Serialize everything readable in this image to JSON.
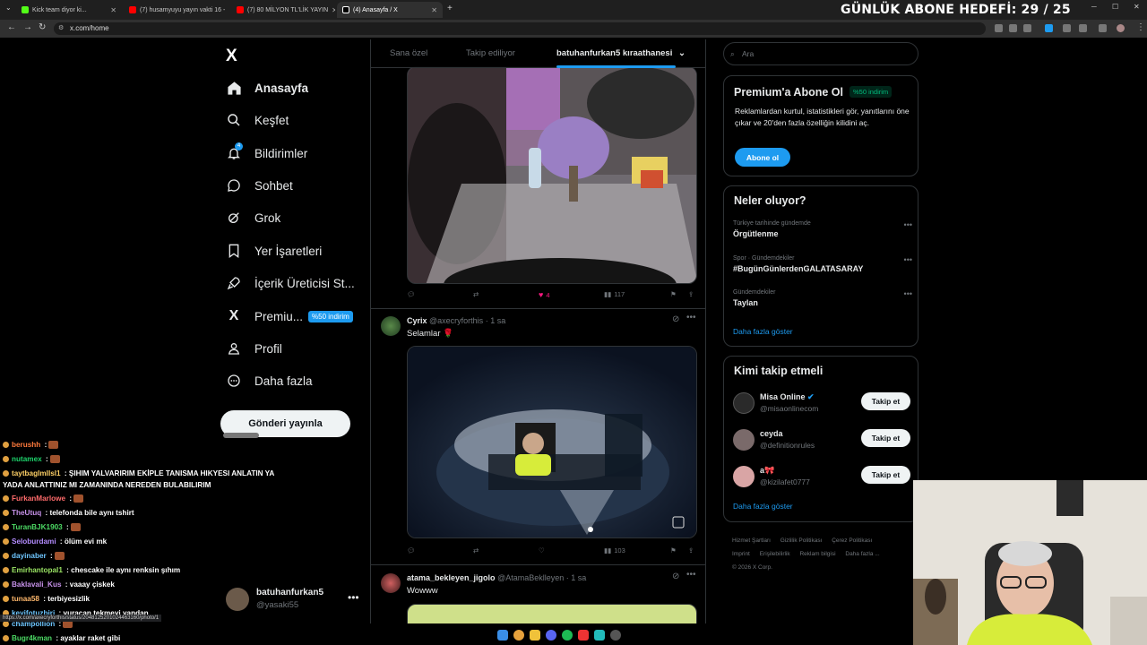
{
  "browser": {
    "tabs": [
      {
        "title": "Kick team diyor ki...",
        "color": "#53fc18"
      },
      {
        "title": "(7) husamyuyu yayın vakti 16 -",
        "color": "#ff0000"
      },
      {
        "title": "(7) 80 MİLYON TL'LİK YAYIN",
        "color": "#ff0000"
      },
      {
        "title": "(4) Anasayfa / X",
        "color": "#ffffff"
      }
    ],
    "url": "x.com/home",
    "new_tab_label": "+"
  },
  "overlay": {
    "goal": "GÜNLÜK ABONE HEDEFİ: 29 / 25"
  },
  "nav": {
    "logo": "X",
    "items": [
      {
        "label": "Anasayfa",
        "icon": "home-icon"
      },
      {
        "label": "Keşfet",
        "icon": "search-icon"
      },
      {
        "label": "Bildirimler",
        "icon": "bell-icon",
        "count": "4"
      },
      {
        "label": "Sohbet",
        "icon": "chat-icon"
      },
      {
        "label": "Grok",
        "icon": "grok-icon"
      },
      {
        "label": "Yer İşaretleri",
        "icon": "bookmark-icon"
      },
      {
        "label": "İçerik Üreticisi St...",
        "icon": "rocket-icon"
      },
      {
        "label": "Premiu...",
        "icon": "x-premium-icon",
        "badge": "%50 indirim"
      },
      {
        "label": "Profil",
        "icon": "person-icon"
      },
      {
        "label": "Daha fazla",
        "icon": "more-icon"
      }
    ],
    "post_button": "Gönderi yayınla",
    "user": {
      "name": "batuhanfurkan5",
      "handle": "@yasaki55"
    }
  },
  "feed": {
    "tabs": [
      "Sana özel",
      "Takip ediliyor",
      "batuhanfurkan5 kıraathanesi"
    ],
    "tweet1": {
      "likes": "4",
      "views": "117",
      "like_color": "#f91880"
    },
    "tweet2": {
      "name": "Cyrix",
      "handle": "@axecryforthis",
      "time": "· 1 sa",
      "text": "Selamlar 🌹",
      "views": "103"
    },
    "tweet3": {
      "name": "atama_bekleyen_jigolo",
      "handle": "@AtamaBeklleyen",
      "time": "· 1 sa",
      "text": "Wowww"
    }
  },
  "sidebar": {
    "search_placeholder": "Ara",
    "premium": {
      "title": "Premium'a Abone Ol",
      "discount": "%50 indirim",
      "desc": "Reklamlardan kurtul, istatistikleri gör, yanıtlarını öne çıkar ve 20'den fazla özelliğin kilidini aç.",
      "button": "Abone ol"
    },
    "trends": {
      "title": "Neler oluyor?",
      "items": [
        {
          "category": "Türkiye tarihinde gündemde",
          "title": "Örgütlenme"
        },
        {
          "category": "Spor · Gündemdekiler",
          "title": "#BugünGünlerdenGALATASARAY"
        },
        {
          "category": "Gündemdekiler",
          "title": "Taylan"
        }
      ],
      "show_more": "Daha fazla göster"
    },
    "who_to_follow": {
      "title": "Kimi takip etmeli",
      "items": [
        {
          "name": "Misa Online",
          "handle": "@misaonlinecom",
          "verified": true
        },
        {
          "name": "ceyda",
          "handle": "@definitionrules"
        },
        {
          "name": "a🎀",
          "handle": "@kizilafet0777"
        }
      ],
      "follow_label": "Takip et",
      "show_more": "Daha fazla göster"
    },
    "footer": {
      "links": [
        "Hizmet Şartları",
        "Gizlilik Politikası",
        "Çerez Politikası",
        "Imprint",
        "Erişilebilirlik",
        "Reklam bilgisi",
        "Daha fazla ..."
      ],
      "copyright": "© 2026 X Corp."
    }
  },
  "chat": [
    {
      "user": "berushh",
      "msg": ":",
      "color": "#ff7a3c"
    },
    {
      "user": "nutamex",
      "msg": ":",
      "color": "#1dd36b"
    },
    {
      "user": "taytbaglmllsl1",
      "msg": ": ŞIHIM YALVARIRIM EKİPLE TANISMA HIKYESI ANLATIN YA YADA ANLATTINIZ MI ZAMANINDA NEREDEN BULABILIRIM",
      "color": "#ffd166"
    },
    {
      "user": "FurkanMarlowe",
      "msg": ":",
      "color": "#ff6b6b"
    },
    {
      "user": "TheUtuq",
      "msg": ": telefonda bile aynı tshirt",
      "color": "#c792ea"
    },
    {
      "user": "TuranBJK1903",
      "msg": ":",
      "color": "#4cd964"
    },
    {
      "user": "Seloburdami",
      "msg": ": ölüm evi mk",
      "color": "#b48cff"
    },
    {
      "user": "dayinaber",
      "msg": ":",
      "color": "#6ec6ff"
    },
    {
      "user": "Emirhantopal1",
      "msg": ": chescake ile aynı renksin şıhım",
      "color": "#9be564"
    },
    {
      "user": "Baklavali_Kus",
      "msg": ": vaaay çiskek",
      "color": "#c792ea"
    },
    {
      "user": "tunaa58",
      "msg": ": terbiyesizlik",
      "color": "#ffb86c"
    },
    {
      "user": "keyifotuzbiri",
      "msg": ": vuracan tekmeyi yandan",
      "color": "#6ec6ff"
    },
    {
      "user": "champollion",
      "msg": ":",
      "color": "#6ec6ff"
    },
    {
      "user": "Bugr4kman",
      "msg": ": ayaklar raket gibi",
      "color": "#4cd964"
    }
  ],
  "status_url": "https://x.com/axecryforthis/status/2048125201024463160/photo/1"
}
